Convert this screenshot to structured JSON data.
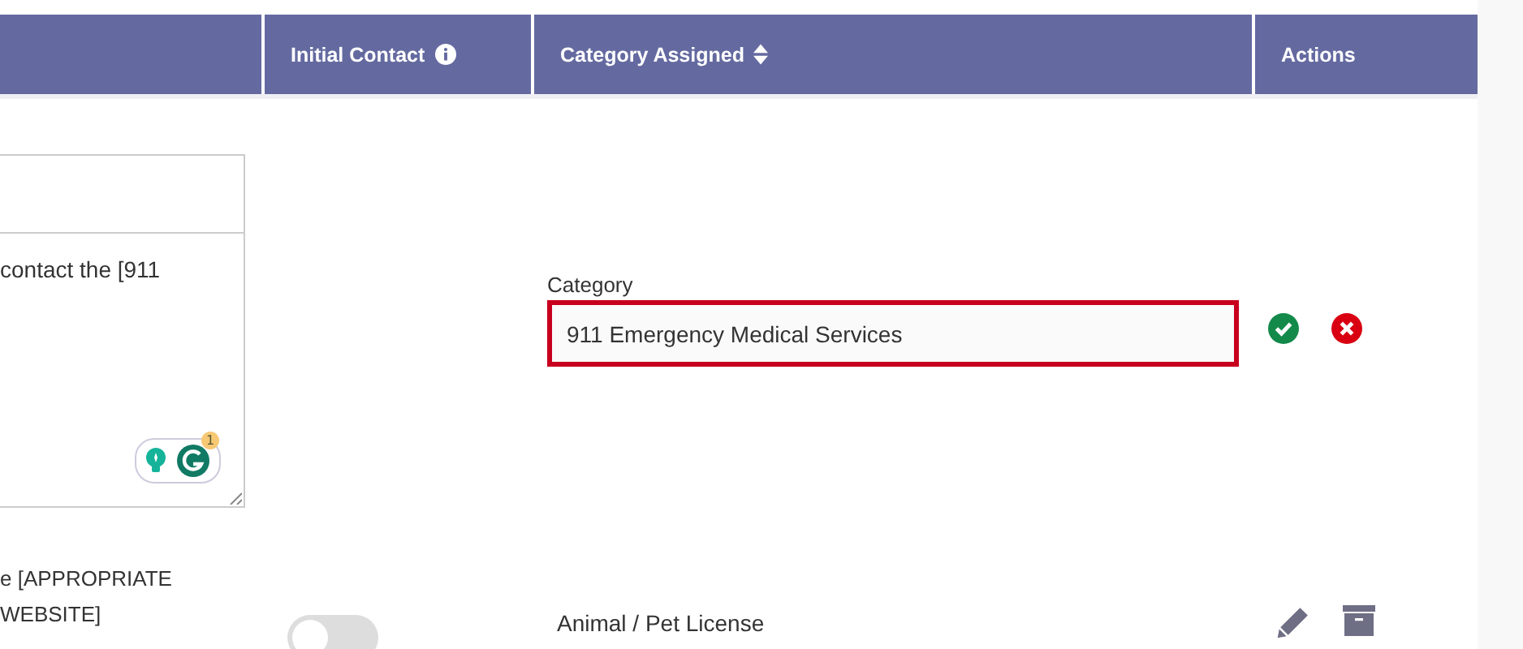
{
  "table": {
    "column_headers": [
      "Initial Contact",
      "Category Assigned",
      "Actions"
    ],
    "rows": [
      {
        "kind": "editing",
        "text_field": "",
        "message": "contact the [911",
        "grammarly_count": "1",
        "category_label": "Category",
        "category_value": "911 Emergency Medical Services"
      },
      {
        "kind": "view",
        "message": "e [APPROPRIATE\nWEBSITE]",
        "initial_contact_on": false,
        "category": "Animal / Pet License"
      }
    ]
  }
}
